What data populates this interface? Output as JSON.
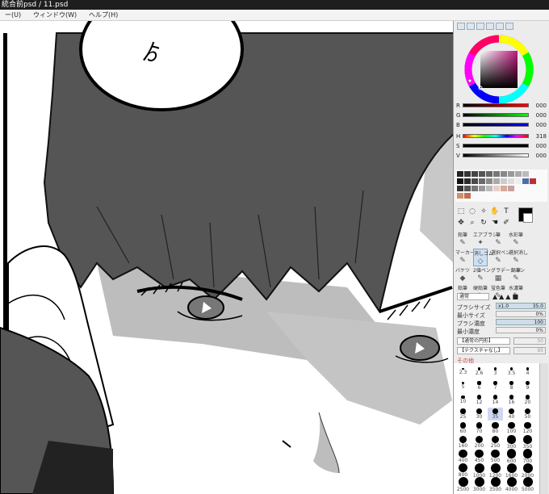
{
  "window": {
    "title": "統合前psd / 11.psd"
  },
  "menu": {
    "items": [
      "ー(U)",
      "ウィンドウ(W)",
      "ヘルプ(H)"
    ]
  },
  "canvas": {
    "speech_text": "ゟ"
  },
  "color": {
    "current_hex": "#000000",
    "sliders": [
      {
        "label": "R",
        "value": "000"
      },
      {
        "label": "G",
        "value": "000"
      },
      {
        "label": "B",
        "value": "000"
      },
      {
        "label": "H",
        "value": "318"
      },
      {
        "label": "S",
        "value": "000"
      },
      {
        "label": "V",
        "value": "000"
      }
    ]
  },
  "tools": {
    "text_tool": "T",
    "brushes": [
      {
        "label": "鉛筆",
        "icon": "✎"
      },
      {
        "label": "エアブラシ",
        "icon": "✦"
      },
      {
        "label": "筆",
        "icon": "✎"
      },
      {
        "label": "水彩筆",
        "icon": "✎"
      },
      {
        "label": "マーカー",
        "icon": "✎"
      },
      {
        "label": "消しゴム",
        "icon": "◇"
      },
      {
        "label": "選択ペン",
        "icon": "✎"
      },
      {
        "label": "選択消し",
        "icon": "✎"
      },
      {
        "label": "バケツ",
        "icon": "◆"
      },
      {
        "label": "2値ペン",
        "icon": "✎"
      },
      {
        "label": "グラデーション",
        "icon": "▦"
      },
      {
        "label": "鉛筆",
        "icon": "✎"
      },
      {
        "label": "鉛筆",
        "icon": "✎"
      },
      {
        "label": "硬鉛筆",
        "icon": "✎"
      },
      {
        "label": "蛍色筆",
        "icon": "✎"
      },
      {
        "label": "水濃筆",
        "icon": "✎"
      }
    ]
  },
  "brush_props": {
    "blend_mode": "通常",
    "size_label": "ブラシサイズ",
    "size_multiplier": "x1.0",
    "size_value": "35.0",
    "min_size_label": "最小サイズ",
    "min_size_value": "0%",
    "density_label": "ブラシ濃度",
    "density_value": "100",
    "min_density_label": "最小濃度",
    "min_density_value": "0%",
    "shape_dropdown": "【通常の円形】",
    "shape_value": "50",
    "texture_dropdown": "【テクスチャなし】",
    "texture_value": "95",
    "other_label": "その他"
  },
  "brush_sizes": [
    "2.3",
    "2.6",
    "3",
    "3.5",
    "4",
    "5",
    "6",
    "7",
    "8",
    "9",
    "10",
    "12",
    "14",
    "16",
    "20",
    "25",
    "30",
    "35",
    "40",
    "50",
    "60",
    "70",
    "80",
    "100",
    "120",
    "160",
    "200",
    "250",
    "300",
    "350",
    "400",
    "450",
    "500",
    "600",
    "700",
    "800",
    "1000",
    "1200",
    "1600",
    "2000",
    "2500",
    "3000",
    "3500",
    "4000",
    "5000"
  ],
  "selected_brush_size": "35"
}
